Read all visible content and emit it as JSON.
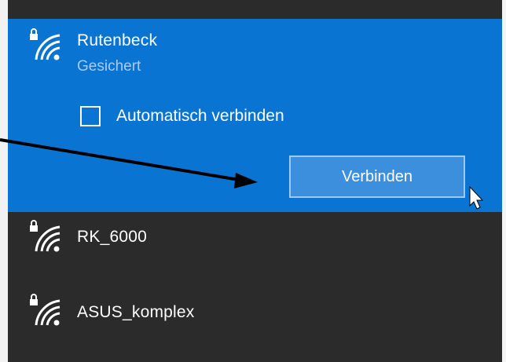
{
  "networks": {
    "selected": {
      "ssid": "Rutenbeck",
      "status": "Gesichert",
      "auto_connect_label": "Automatisch verbinden",
      "auto_connect_checked": false,
      "connect_label": "Verbinden"
    },
    "others": [
      {
        "ssid": "RK_6000"
      },
      {
        "ssid": "ASUS_komplex"
      }
    ]
  },
  "icons": {
    "wifi": "wifi-secured-icon",
    "checkbox": "checkbox-icon",
    "pointer": "mouse-pointer-icon",
    "annotation": "annotation-arrow-icon"
  },
  "colors": {
    "selected_background": "#0a74d3",
    "list_background": "#2b2b2b",
    "status_text": "#a9cbf2"
  }
}
